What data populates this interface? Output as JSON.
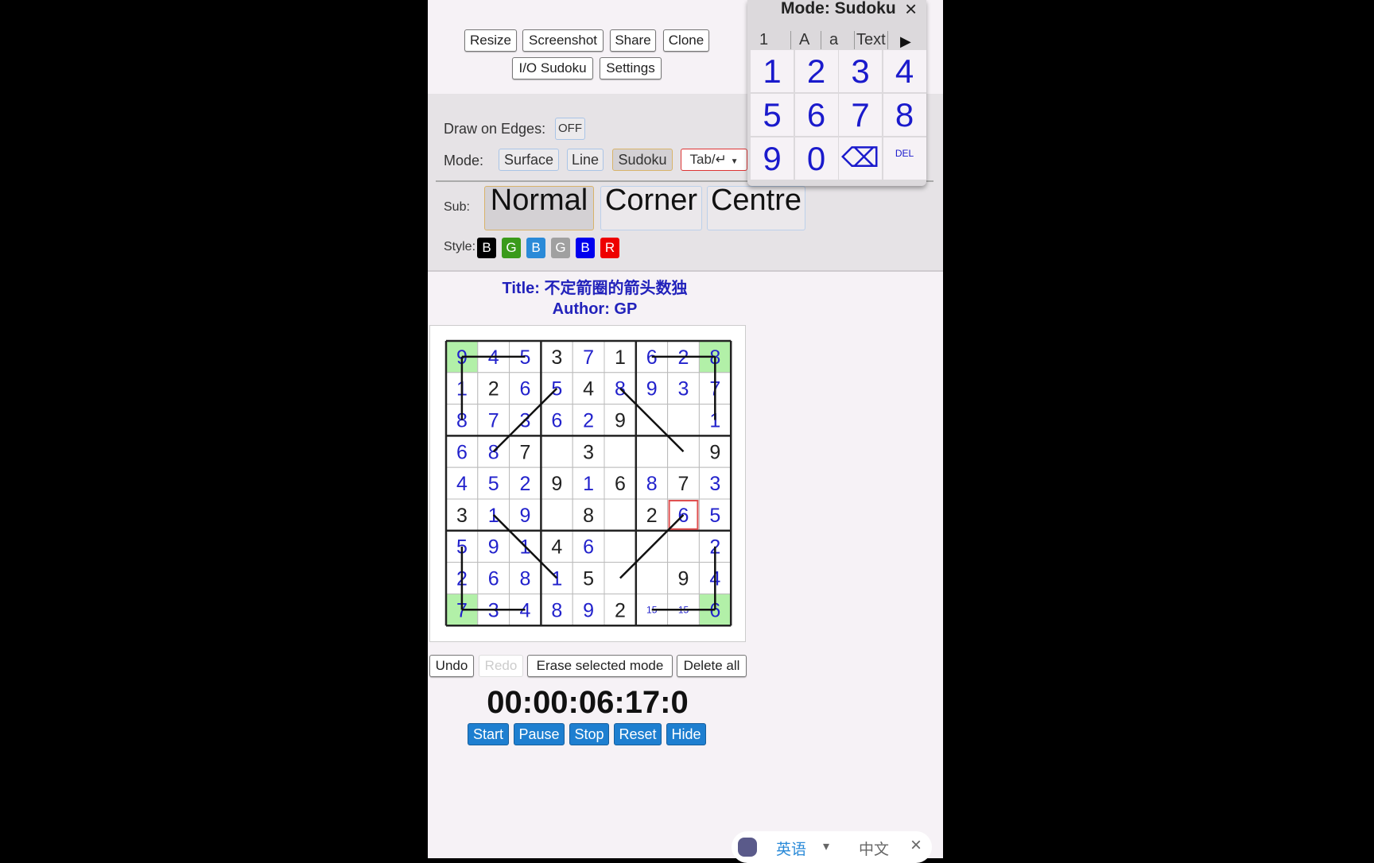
{
  "toolbar": {
    "row1": [
      "Resize",
      "Screenshot",
      "Share",
      "Clone"
    ],
    "row2": [
      "I/O Sudoku",
      "Settings"
    ]
  },
  "panel": {
    "draw_edges_label": "Draw on Edges:",
    "draw_edges_value": "OFF",
    "mode_label": "Mode:",
    "modes": [
      "Surface",
      "Line",
      "Sudoku"
    ],
    "active_mode": "Sudoku",
    "dropdown": "Tab/↵",
    "sub_label": "Sub:",
    "subs": [
      "Normal",
      "Corner",
      "Centre"
    ],
    "active_sub": "Normal",
    "style_label": "Style:",
    "styles": [
      {
        "l": "B",
        "c": "#000000"
      },
      {
        "l": "G",
        "c": "#3a9a1a"
      },
      {
        "l": "B",
        "c": "#2a8ad8"
      },
      {
        "l": "G",
        "c": "#a0a0a0"
      },
      {
        "l": "B",
        "c": "#0000ee"
      },
      {
        "l": "R",
        "c": "#ee0000"
      }
    ]
  },
  "puzzle": {
    "title": "Title: 不定箭圈的箭头数独",
    "author": "Author: GP"
  },
  "grid": {
    "given_color": "#222222",
    "user_color": "#2222cc",
    "highlight_color": "#b2f0a8",
    "selected_color": "#e05050",
    "rows": [
      [
        "9u",
        "4u",
        "5u",
        "3b",
        "7u",
        "1b",
        "6u",
        "2u",
        "8u"
      ],
      [
        "1u",
        "2b",
        "6u",
        "5u",
        "4b",
        "8u",
        "9u",
        "3u",
        "7u"
      ],
      [
        "8u",
        "7u",
        "3u",
        "6u",
        "2u",
        "9b",
        "",
        "",
        "1u"
      ],
      [
        "6u",
        "8u",
        "7b",
        "",
        "3b",
        "",
        "",
        "",
        "9b"
      ],
      [
        "4u",
        "5u",
        "2u",
        "9b",
        "1u",
        "6b",
        "8u",
        "7b",
        "3u"
      ],
      [
        "3b",
        "1u",
        "9u",
        "",
        "8b",
        "",
        "2b",
        "6u",
        "5u"
      ],
      [
        "5u",
        "9u",
        "1u",
        "4b",
        "6u",
        "",
        "",
        "",
        "2u"
      ],
      [
        "2u",
        "6u",
        "8u",
        "1u",
        "5b",
        "",
        "",
        "9b",
        "4u"
      ],
      [
        "7u",
        "3u",
        "4u",
        "8u",
        "9u",
        "2b",
        "15s",
        "15s",
        "6u"
      ]
    ],
    "highlighted_cells": [
      [
        1,
        1
      ],
      [
        1,
        9
      ],
      [
        9,
        1
      ],
      [
        9,
        9
      ]
    ],
    "selected_cell": [
      6,
      8
    ],
    "lines": [
      [
        [
          1,
          1
        ],
        [
          1,
          3
        ]
      ],
      [
        [
          1,
          1
        ],
        [
          3,
          1
        ]
      ],
      [
        [
          1,
          7
        ],
        [
          1,
          9
        ]
      ],
      [
        [
          1,
          9
        ],
        [
          3,
          9
        ]
      ],
      [
        [
          7,
          1
        ],
        [
          9,
          1
        ]
      ],
      [
        [
          9,
          1
        ],
        [
          9,
          3
        ]
      ],
      [
        [
          9,
          7
        ],
        [
          9,
          9
        ]
      ],
      [
        [
          7,
          9
        ],
        [
          9,
          9
        ]
      ],
      [
        [
          2,
          4
        ],
        [
          4,
          2
        ]
      ],
      [
        [
          2,
          6
        ],
        [
          4,
          8
        ]
      ],
      [
        [
          6,
          2
        ],
        [
          8,
          4
        ]
      ],
      [
        [
          6,
          8
        ],
        [
          8,
          6
        ]
      ]
    ]
  },
  "actions": {
    "undo": "Undo",
    "redo": "Redo",
    "erase": "Erase selected mode",
    "delete_all": "Delete all"
  },
  "timer": {
    "value": "00:00:06:17:0",
    "buttons": [
      "Start",
      "Pause",
      "Stop",
      "Reset",
      "Hide"
    ]
  },
  "popup": {
    "title": "Mode: Sudoku",
    "close": "×",
    "tabs": [
      "1",
      "A",
      "a",
      "Text"
    ],
    "next": "▶",
    "keys": [
      "1",
      "2",
      "3",
      "4",
      "5",
      "6",
      "7",
      "8",
      "9",
      "0",
      "⌫",
      "DEL"
    ]
  },
  "ime": {
    "lang": "英语",
    "dropdown": "▾",
    "alt": "中文",
    "close": "×"
  }
}
